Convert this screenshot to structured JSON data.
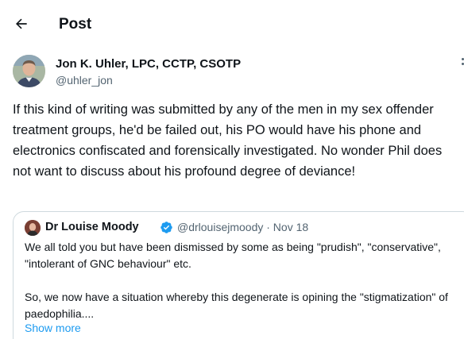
{
  "header": {
    "title": "Post",
    "back_icon": "arrow-left-icon"
  },
  "author": {
    "name": "Jon K. Uhler, LPC, CCTP, CSOTP",
    "handle": "@uhler_jon"
  },
  "tweet": {
    "text": "If this kind of writing was submitted by any of the men in my sex offender treatment groups, he'd be failed out, his PO would have his phone and electronics confiscated and forensically investigated. No wonder Phil does not want to discuss about his profound degree of deviance!"
  },
  "quote": {
    "name": "Dr Louise Moody",
    "meta": "@drlouisejmoody · Nov 18",
    "verified_icon": "verified-badge-icon",
    "paragraph1": "We all told you but have been dismissed by some as being \"prudish\", \"conservative\", \"intolerant of GNC behaviour\" etc.",
    "paragraph2": "So, we now have a situation whereby this degenerate is opining the \"stigmatization\" of paedophilia....",
    "show_more": "Show more"
  },
  "colors": {
    "text": "#0f1419",
    "secondary": "#536471",
    "accent": "#1d9bf0",
    "border": "#cfd9de"
  }
}
